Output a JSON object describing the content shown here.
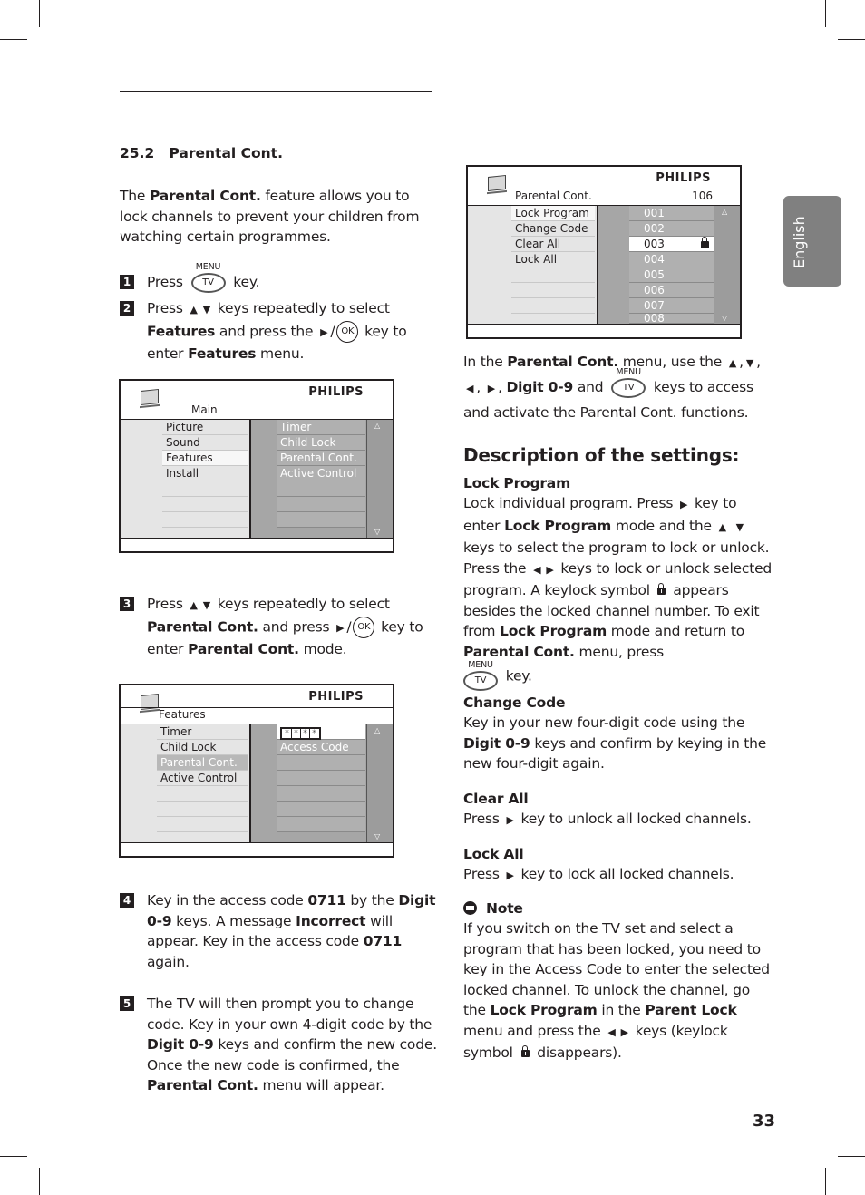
{
  "section": {
    "number": "25.2",
    "title": "Parental Cont."
  },
  "intro": {
    "pre": "The ",
    "bold": "Parental Cont.",
    "post": " feature allows you to lock channels to prevent your children from watching certain programmes."
  },
  "keys": {
    "menu_label": "MENU",
    "tv_label": "TV",
    "ok_label": "OK",
    "up": "▲",
    "down": "▼",
    "left": "◀",
    "right": "▶"
  },
  "steps": [
    {
      "num": "1",
      "a": "Press",
      "b": "key."
    },
    {
      "num": "2",
      "a": "Press",
      "b": "keys repeatedly to select",
      "c": "Features",
      "d": "and press the",
      "e": "key to enter",
      "f": "Features",
      "g": "menu."
    },
    {
      "num": "3",
      "a": "Press",
      "b": "keys repeatedly to select",
      "c": "Parental Cont.",
      "d": "and press",
      "e": "key to enter",
      "f": "Parental Cont.",
      "g": "mode."
    },
    {
      "num": "4",
      "a": "Key in the access code",
      "b": "0711",
      "c": "by the",
      "d": "Digit 0-9",
      "e": "keys. A message",
      "f": "Incorrect",
      "g": "will appear. Key in the access code",
      "h": "0711",
      "i": "again."
    },
    {
      "num": "5",
      "a": "The TV will then prompt you to change code. Key in your own 4-digit code by the",
      "b": "Digit 0-9",
      "c": "keys and confirm the new code. Once the new code is confirmed, the",
      "d": "Parental Cont.",
      "e": "menu will appear."
    }
  ],
  "screens": {
    "brand": "PHILIPS",
    "main": {
      "crumb": "Main",
      "left": [
        "Picture",
        "Sound",
        "Features",
        "Install"
      ],
      "selected": "Features",
      "right": [
        "Timer",
        "Child Lock",
        "Parental Cont.",
        "Active Control"
      ]
    },
    "features": {
      "crumb": "Features",
      "left": [
        "Timer",
        "Child Lock",
        "Parental Cont.",
        "Active Control"
      ],
      "selected": "Parental Cont.",
      "code_mask": [
        "*",
        "*",
        "*",
        "*"
      ],
      "right": [
        "Access Code"
      ]
    },
    "parental": {
      "crumb": "Parental Cont.",
      "channel": "106",
      "left": [
        "Lock Program",
        "Change Code",
        "Clear All",
        "Lock All"
      ],
      "selected": "Lock Program",
      "programs": [
        "001",
        "002",
        "003",
        "004",
        "005",
        "006",
        "007",
        "008"
      ],
      "locked_program": "003"
    }
  },
  "right_intro": {
    "a": "In the",
    "b": "Parental Cont.",
    "c": "menu, use the",
    "d": "Digit 0-9",
    "e": "and",
    "f": "keys to access and activate the Parental Cont. functions."
  },
  "description": {
    "heading": "Description of the settings:",
    "lock_program": {
      "title": "Lock Program",
      "a": "Lock individual program. Press",
      "b": "key to enter",
      "c": "Lock Program",
      "d": "mode and the",
      "e": "keys to select the program to lock or unlock. Press the",
      "f": "keys to lock or unlock selected program. A keylock symbol",
      "g": "appears besides the locked channel number. To exit from",
      "h": "Lock Program",
      "i": "mode and return to",
      "j": "Parental Cont.",
      "k": "menu, press",
      "l": "key."
    },
    "change_code": {
      "title": "Change Code",
      "a": "Key in your new four-digit code using the",
      "b": "Digit 0-9",
      "c": "keys and confirm by keying in the new four-digit again."
    },
    "clear_all": {
      "title": "Clear All",
      "a": "Press",
      "b": "key to unlock all locked channels."
    },
    "lock_all": {
      "title": "Lock All",
      "a": "Press",
      "b": "key to lock all locked channels."
    },
    "note": {
      "title": "Note",
      "a": "If you switch on the TV set and select a program that has been locked, you need to key in the Access Code to enter the selected locked channel. To unlock the channel, go the",
      "b": "Lock Program",
      "c": "in the",
      "d": "Parent Lock",
      "e": "menu and press the",
      "f": "keys (keylock symbol",
      "g": "disappears)."
    }
  },
  "language_tab": "English",
  "page_number": "33"
}
